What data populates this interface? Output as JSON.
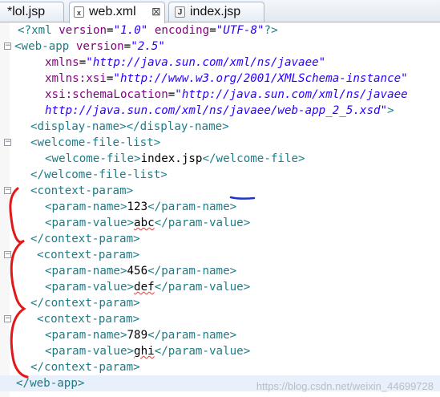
{
  "tabs": [
    {
      "label": "*lol.jsp",
      "icon": "jsp-file-icon",
      "active": false
    },
    {
      "label": "web.xml",
      "icon": "xml-file-icon",
      "active": true
    },
    {
      "label": "index.jsp",
      "icon": "jsp-file-icon",
      "active": false
    }
  ],
  "tab_icon_text": {
    "jsp": "J",
    "xml": "x"
  },
  "close_glyph": "⊠",
  "fold_glyph": "−",
  "code": {
    "xml_decl": {
      "open": "<?xml ",
      "a1": "version",
      "eq": "=",
      "v1": "\"1.0\"",
      "a2": "encoding",
      "v2": "\"UTF-8\"",
      "close": "?>"
    },
    "webapp_open": {
      "open": "<web-app ",
      "attr": "version",
      "eq": "=",
      "val": "\"2.5\""
    },
    "xmlns": {
      "attr": "xmlns",
      "eq": "=",
      "val": "\"http://java.sun.com/xml/ns/javaee\""
    },
    "xmlns_xsi": {
      "attr": "xmlns:xsi",
      "eq": "=",
      "val": "\"http://www.w3.org/2001/XMLSchema-instance\""
    },
    "schema": {
      "attr": "xsi:schemaLocation",
      "eq": "=",
      "val": "\"http://java.sun.com/xml/ns/javaee"
    },
    "schema_cont": {
      "val": "http://java.sun.com/xml/ns/javaee/web-app_2_5.xsd\"",
      "close": ">"
    },
    "display_name": {
      "text": "<display-name></display-name>"
    },
    "welcome_open": "<welcome-file-list>",
    "welcome_file": {
      "open": "<welcome-file>",
      "value": "index.jsp",
      "close": "</welcome-file>"
    },
    "welcome_close": "</welcome-file-list>",
    "params": [
      {
        "open": "<context-param>",
        "name_open": "<param-name>",
        "name": "123",
        "name_close": "</param-name>",
        "value_open": "<param-value>",
        "value": "abc",
        "value_close": "</param-value>",
        "close": "</context-param>"
      },
      {
        "open": "<context-param>",
        "name_open": "<param-name>",
        "name": "456",
        "name_close": "</param-name>",
        "value_open": "<param-value>",
        "value": "def",
        "value_close": "</param-value>",
        "close": "</context-param>"
      },
      {
        "open": "<context-param>",
        "name_open": "<param-name>",
        "name": "789",
        "name_close": "</param-name>",
        "value_open": "<param-value>",
        "value": "ghi",
        "value_close": "</param-value>",
        "close": "</context-param>"
      }
    ],
    "webapp_close": "</web-app>"
  },
  "watermark": "https://blog.csdn.net/weixin_44699728",
  "colors": {
    "tag": "#1f7c88",
    "attribute": "#7f007f",
    "value": "#2a00ff",
    "annotation": "#e01818",
    "underline": "#2233cc"
  }
}
